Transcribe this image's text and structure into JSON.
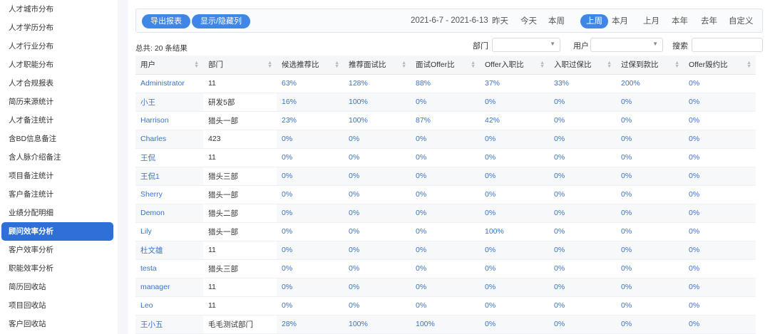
{
  "sidebar": {
    "items": [
      {
        "label": "人才城市分布",
        "active": false
      },
      {
        "label": "人才学历分布",
        "active": false
      },
      {
        "label": "人才行业分布",
        "active": false
      },
      {
        "label": "人才职能分布",
        "active": false
      },
      {
        "label": "人才合规报表",
        "active": false
      },
      {
        "label": "简历来源统计",
        "active": false
      },
      {
        "label": "人才备注统计",
        "active": false
      },
      {
        "label": "含BD信息备注",
        "active": false
      },
      {
        "label": "含人脉介绍备注",
        "active": false
      },
      {
        "label": "项目备注统计",
        "active": false
      },
      {
        "label": "客户备注统计",
        "active": false
      },
      {
        "label": "业绩分配明细",
        "active": false
      },
      {
        "label": "顾问效率分析",
        "active": true
      },
      {
        "label": "客户效率分析",
        "active": false
      },
      {
        "label": "职能效率分析",
        "active": false
      },
      {
        "label": "简历回收站",
        "active": false
      },
      {
        "label": "项目回收站",
        "active": false
      },
      {
        "label": "客户回收站",
        "active": false
      }
    ]
  },
  "toolbar": {
    "export_label": "导出报表",
    "toggle_columns_label": "显示/隐藏列",
    "date_range": "2021-6-7 - 2021-6-13",
    "periods": [
      "昨天",
      "今天",
      "本周",
      "上周",
      "本月",
      "上月",
      "本年",
      "去年",
      "自定义"
    ],
    "active_period": "上周"
  },
  "filters": {
    "total_text": "总共: 20 条结果",
    "department_label": "部门",
    "user_label": "用户",
    "search_label": "搜索",
    "search_value": ""
  },
  "colors": {
    "accent": "#3f86e6",
    "active_nav": "#2f6fd8",
    "link": "#3a72c8"
  },
  "table": {
    "columns": [
      "用户",
      "部门",
      "候选推荐比",
      "推荐面试比",
      "面试Offer比",
      "Offer入职比",
      "入职过保比",
      "过保到款比",
      "Offer毁约比"
    ],
    "rows": [
      [
        "Administrator",
        "11",
        "63%",
        "128%",
        "88%",
        "37%",
        "33%",
        "200%",
        "0%"
      ],
      [
        "小王",
        "研发5部",
        "16%",
        "100%",
        "0%",
        "0%",
        "0%",
        "0%",
        "0%"
      ],
      [
        "Harrison",
        "猎头一部",
        "23%",
        "100%",
        "87%",
        "42%",
        "0%",
        "0%",
        "0%"
      ],
      [
        "Charles",
        "423",
        "0%",
        "0%",
        "0%",
        "0%",
        "0%",
        "0%",
        "0%"
      ],
      [
        "王侃",
        "11",
        "0%",
        "0%",
        "0%",
        "0%",
        "0%",
        "0%",
        "0%"
      ],
      [
        "王侃1",
        "猎头三部",
        "0%",
        "0%",
        "0%",
        "0%",
        "0%",
        "0%",
        "0%"
      ],
      [
        "Sherry",
        "猎头一部",
        "0%",
        "0%",
        "0%",
        "0%",
        "0%",
        "0%",
        "0%"
      ],
      [
        "Demon",
        "猎头二部",
        "0%",
        "0%",
        "0%",
        "0%",
        "0%",
        "0%",
        "0%"
      ],
      [
        "Lily",
        "猎头一部",
        "0%",
        "0%",
        "0%",
        "100%",
        "0%",
        "0%",
        "0%"
      ],
      [
        "杜文雄",
        "11",
        "0%",
        "0%",
        "0%",
        "0%",
        "0%",
        "0%",
        "0%"
      ],
      [
        "testa",
        "猎头三部",
        "0%",
        "0%",
        "0%",
        "0%",
        "0%",
        "0%",
        "0%"
      ],
      [
        "manager",
        "11",
        "0%",
        "0%",
        "0%",
        "0%",
        "0%",
        "0%",
        "0%"
      ],
      [
        "Leo",
        "11",
        "0%",
        "0%",
        "0%",
        "0%",
        "0%",
        "0%",
        "0%"
      ],
      [
        "王小五",
        "毛毛测试部门",
        "28%",
        "100%",
        "100%",
        "0%",
        "0%",
        "0%",
        "0%"
      ]
    ]
  }
}
